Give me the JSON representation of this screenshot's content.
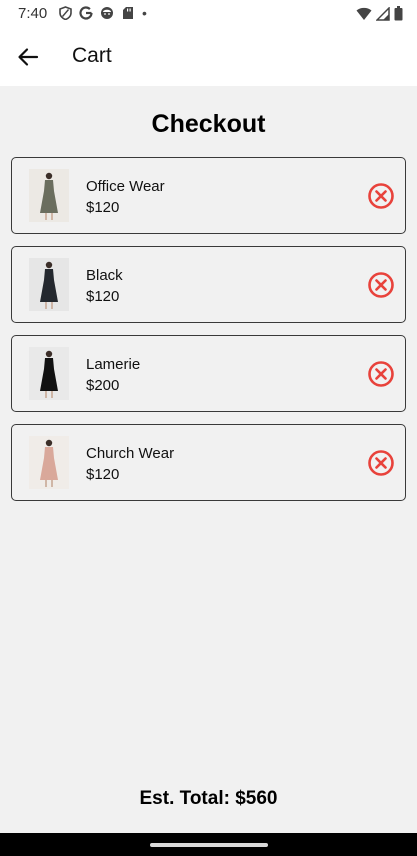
{
  "status_bar": {
    "time": "7:40",
    "dot": "•",
    "left_icons": [
      "shield-icon",
      "google-g-icon",
      "face-icon",
      "sd-card-icon"
    ],
    "right_icons": [
      "wifi-icon",
      "cell-signal-icon",
      "battery-icon"
    ]
  },
  "app_bar": {
    "title": "Cart",
    "back_icon": "arrow-left-icon"
  },
  "page": {
    "title": "Checkout",
    "est_total": "Est. Total: $560"
  },
  "cart_items": [
    {
      "name": "Office Wear",
      "price": "$120",
      "dress_color": "#6b6e5e",
      "bg_color": "#ece9e4"
    },
    {
      "name": "Black",
      "price": "$120",
      "dress_color": "#24282e",
      "bg_color": "#e6e6e6"
    },
    {
      "name": "Lamerie",
      "price": "$200",
      "dress_color": "#111111",
      "bg_color": "#e9e9e9"
    },
    {
      "name": "Church Wear",
      "price": "$120",
      "dress_color": "#d9a89a",
      "bg_color": "#f0ece8"
    }
  ],
  "colors": {
    "remove_icon": "#e8423b",
    "background": "#f1f1f1",
    "card_border": "#3a3a3a"
  }
}
